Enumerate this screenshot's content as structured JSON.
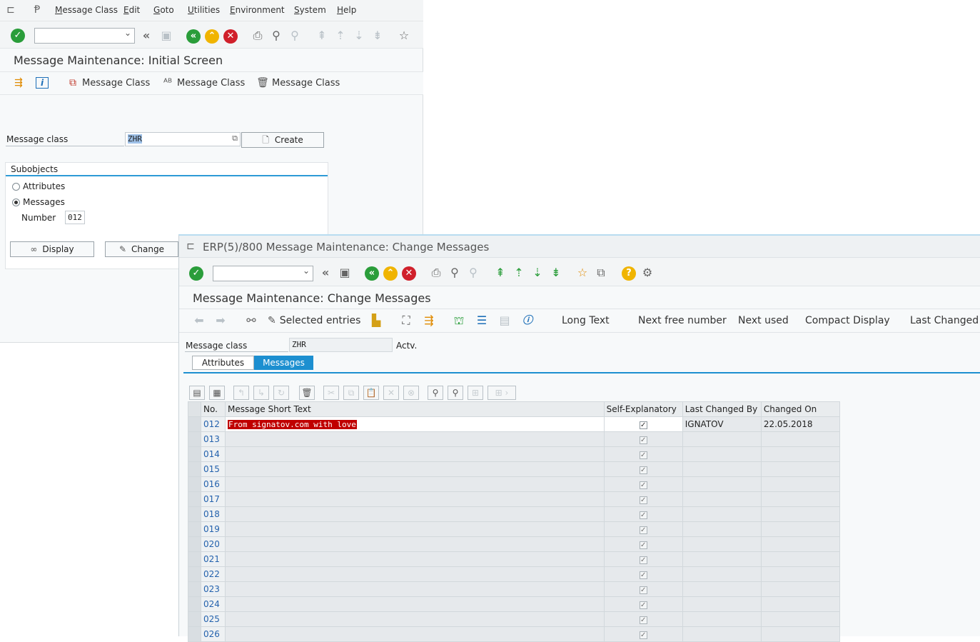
{
  "back_window": {
    "menu": [
      "Message Class",
      "Edit",
      "Goto",
      "Utilities",
      "Environment",
      "System",
      "Help"
    ],
    "title": "Message Maintenance: Initial Screen",
    "app_toolbar": [
      "Message Class",
      "Message Class",
      "Message Class"
    ],
    "message_class_label": "Message class",
    "message_class_value": "ZHR",
    "create_label": "Create",
    "subobjects_title": "Subobjects",
    "radio_attributes": "Attributes",
    "radio_messages": "Messages",
    "number_label": "Number",
    "number_value": "012",
    "display_label": "Display",
    "change_label": "Change"
  },
  "front_window": {
    "window_title": "ERP(5)/800 Message Maintenance: Change Messages",
    "title": "Message Maintenance: Change Messages",
    "app_toolbar": {
      "selected_entries": "Selected entries",
      "long_text": "Long Text",
      "next_free_number": "Next free number",
      "next_used": "Next used",
      "compact_display": "Compact Display",
      "last_changed_by": "Last Changed By"
    },
    "message_class_label": "Message class",
    "message_class_value": "ZHR",
    "status": "Actv.",
    "tabs": [
      "Attributes",
      "Messages"
    ],
    "columns": [
      "No.",
      "Message Short Text",
      "Self-Explanatory",
      "Last Changed By",
      "Changed On"
    ],
    "rows": [
      {
        "no": "012",
        "text": "From signatov.com with love",
        "checked": true,
        "changed_by": "IGNATOV",
        "changed_on": "22.05.2018"
      },
      {
        "no": "013",
        "text": "",
        "checked": true,
        "changed_by": "",
        "changed_on": ""
      },
      {
        "no": "014",
        "text": "",
        "checked": true,
        "changed_by": "",
        "changed_on": ""
      },
      {
        "no": "015",
        "text": "",
        "checked": true,
        "changed_by": "",
        "changed_on": ""
      },
      {
        "no": "016",
        "text": "",
        "checked": true,
        "changed_by": "",
        "changed_on": ""
      },
      {
        "no": "017",
        "text": "",
        "checked": true,
        "changed_by": "",
        "changed_on": ""
      },
      {
        "no": "018",
        "text": "",
        "checked": true,
        "changed_by": "",
        "changed_on": ""
      },
      {
        "no": "019",
        "text": "",
        "checked": true,
        "changed_by": "",
        "changed_on": ""
      },
      {
        "no": "020",
        "text": "",
        "checked": true,
        "changed_by": "",
        "changed_on": ""
      },
      {
        "no": "021",
        "text": "",
        "checked": true,
        "changed_by": "",
        "changed_on": ""
      },
      {
        "no": "022",
        "text": "",
        "checked": true,
        "changed_by": "",
        "changed_on": ""
      },
      {
        "no": "023",
        "text": "",
        "checked": true,
        "changed_by": "",
        "changed_on": ""
      },
      {
        "no": "024",
        "text": "",
        "checked": true,
        "changed_by": "",
        "changed_on": ""
      },
      {
        "no": "025",
        "text": "",
        "checked": true,
        "changed_by": "",
        "changed_on": ""
      },
      {
        "no": "026",
        "text": "",
        "checked": true,
        "changed_by": "",
        "changed_on": ""
      }
    ]
  },
  "colors": {
    "accent": "#1d8fd0",
    "ok": "#2a9d3a",
    "cancel": "#d0202b",
    "exit": "#f0b400",
    "highlight_text_bg": "#c00000"
  }
}
